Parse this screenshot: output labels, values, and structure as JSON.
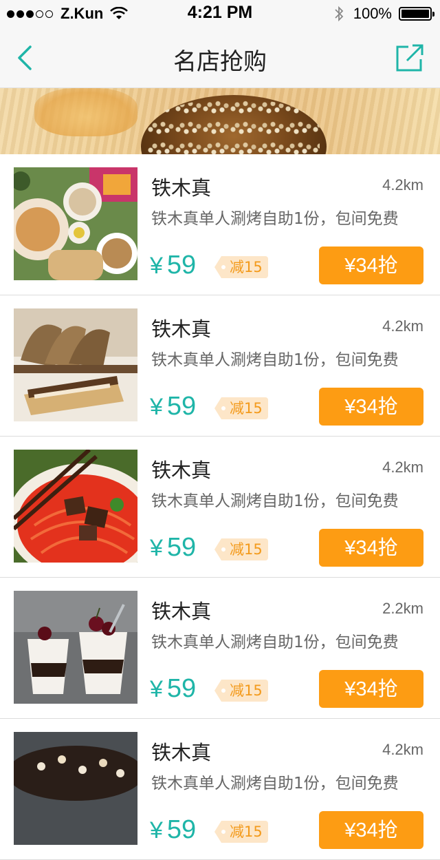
{
  "status_bar": {
    "carrier": "Z.Kun",
    "time": "4:21 PM",
    "battery": "100%",
    "signal_dots": [
      true,
      true,
      true,
      false,
      false
    ]
  },
  "nav": {
    "title": "名店抢购",
    "back_icon": "chevron-left-icon",
    "share_icon": "share-external-icon",
    "accent_color": "#1fb5a8"
  },
  "colors": {
    "price": "#1fb5a8",
    "buy_button": "#fd9c13",
    "discount_bg": "#fde6c8",
    "discount_text": "#f39a1b"
  },
  "items": [
    {
      "name": "铁木真",
      "distance": "4.2km",
      "desc": "铁木真单人涮烤自助1份，包间免费",
      "currency": "¥",
      "price": "59",
      "discount": "减15",
      "buy_label": "¥34抢"
    },
    {
      "name": "铁木真",
      "distance": "4.2km",
      "desc": "铁木真单人涮烤自助1份，包间免费",
      "currency": "¥",
      "price": "59",
      "discount": "减15",
      "buy_label": "¥34抢"
    },
    {
      "name": "铁木真",
      "distance": "4.2km",
      "desc": "铁木真单人涮烤自助1份，包间免费",
      "currency": "¥",
      "price": "59",
      "discount": "减15",
      "buy_label": "¥34抢"
    },
    {
      "name": "铁木真",
      "distance": "2.2km",
      "desc": "铁木真单人涮烤自助1份，包间免费",
      "currency": "¥",
      "price": "59",
      "discount": "减15",
      "buy_label": "¥34抢"
    },
    {
      "name": "铁木真",
      "distance": "4.2km",
      "desc": "铁木真单人涮烤自助1份，包间免费",
      "currency": "¥",
      "price": "59",
      "discount": "减15",
      "buy_label": "¥34抢"
    }
  ]
}
